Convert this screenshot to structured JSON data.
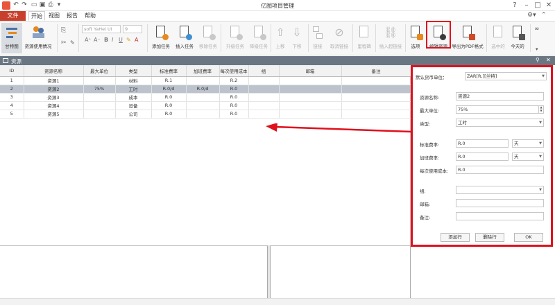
{
  "window": {
    "title": "亿图项目管理"
  },
  "menu": {
    "file": "文件",
    "tabs": [
      "开始",
      "视图",
      "报告",
      "帮助"
    ]
  },
  "ribbon": {
    "font_name": "soft YaHei UI",
    "font_size": "9",
    "buttons": {
      "gantt": "甘特图",
      "resource_usage": "资源使用情况",
      "add_task": "添加任务",
      "insert_task": "插入任务",
      "remove_task": "移除任务",
      "upgrade_task": "升级任务",
      "downgrade_task": "降级任务",
      "move_up": "上移",
      "move_down": "下移",
      "link": "链接",
      "unlink": "取消链接",
      "milestone": "里程碑",
      "insert_hyperlink": "插入超链接",
      "options": "选项",
      "edit_resource": "编辑资源",
      "export_pdf": "导出为PDF格式",
      "selected": "选中的",
      "today": "今天的"
    }
  },
  "pane": {
    "title": "资源"
  },
  "grid": {
    "columns": [
      "ID",
      "资源名称",
      "最大单位",
      "类型",
      "标准费率",
      "加班费率",
      "每次使用成本",
      "组",
      "邮箱",
      "备注"
    ],
    "rows": [
      [
        "1",
        "资源1",
        "",
        "材料",
        "R.1",
        "",
        "R.2",
        "",
        "",
        ""
      ],
      [
        "2",
        "资源2",
        "75%",
        "工时",
        "R.0/d",
        "R.0/d",
        "R.0",
        "",
        "",
        ""
      ],
      [
        "3",
        "资源3",
        "",
        "成本",
        "R.0",
        "",
        "R.0",
        "",
        "",
        ""
      ],
      [
        "4",
        "资源4",
        "",
        "设备",
        "R.0",
        "",
        "R.0",
        "",
        "",
        ""
      ],
      [
        "5",
        "资源5",
        "",
        "公司",
        "R.0",
        "",
        "R.0",
        "",
        "",
        ""
      ]
    ],
    "selected_row": 2
  },
  "panel": {
    "currency_label": "默认货币单位：",
    "currency_value": "ZAR[R,][兰特]",
    "name_label": "资源名称:",
    "name_value": "资源2",
    "max_unit_label": "最大单位:",
    "max_unit_value": "75%",
    "type_label": "类型:",
    "type_value": "工时",
    "std_rate_label": "标准费率:",
    "std_rate_value": "R.0",
    "std_rate_unit": "天",
    "ot_rate_label": "加班费率:",
    "ot_rate_value": "R.0",
    "ot_rate_unit": "天",
    "cost_per_use_label": "每次使用成本:",
    "cost_per_use_value": "R.0",
    "group_label": "组:",
    "group_value": "",
    "email_label": "邮箱:",
    "email_value": "",
    "note_label": "备注:",
    "note_value": "",
    "add_button": "添加行",
    "delete_button": "删除行",
    "ok_button": "OK"
  },
  "colors": {
    "accent_red": "#e0101c",
    "file_tab": "#c8402c",
    "pane_header": "#6a7682",
    "selected_row": "#bcc3cc"
  }
}
